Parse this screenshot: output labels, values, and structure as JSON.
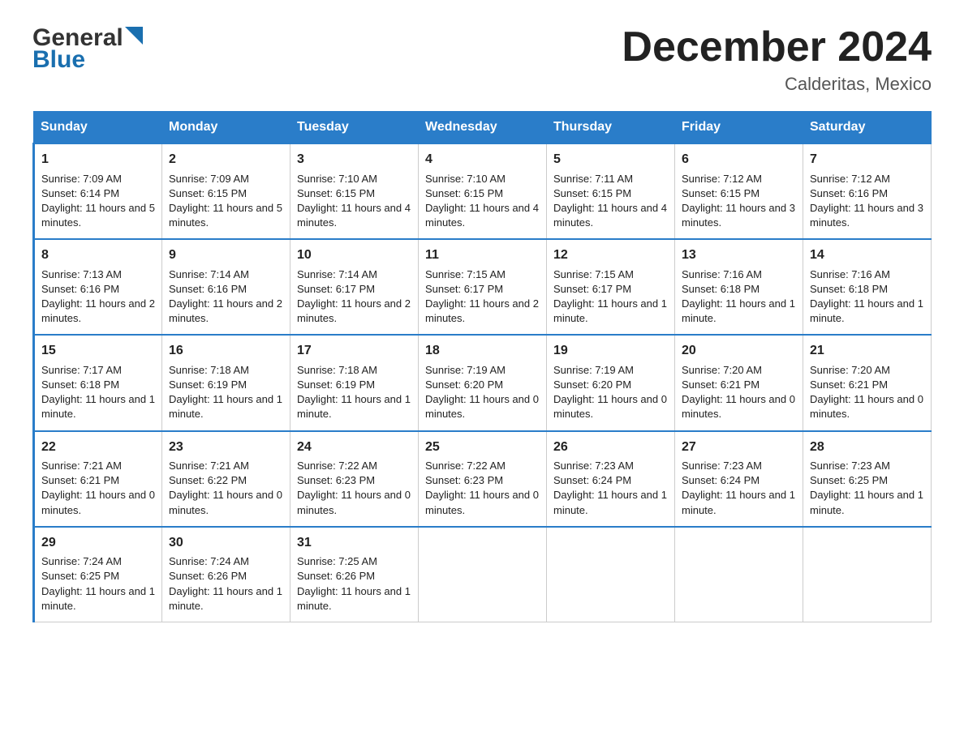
{
  "header": {
    "logo_general": "General",
    "logo_blue": "Blue",
    "month_title": "December 2024",
    "location": "Calderitas, Mexico"
  },
  "days_of_week": [
    "Sunday",
    "Monday",
    "Tuesday",
    "Wednesday",
    "Thursday",
    "Friday",
    "Saturday"
  ],
  "weeks": [
    [
      {
        "day": "1",
        "sunrise": "7:09 AM",
        "sunset": "6:14 PM",
        "daylight": "11 hours and 5 minutes."
      },
      {
        "day": "2",
        "sunrise": "7:09 AM",
        "sunset": "6:15 PM",
        "daylight": "11 hours and 5 minutes."
      },
      {
        "day": "3",
        "sunrise": "7:10 AM",
        "sunset": "6:15 PM",
        "daylight": "11 hours and 4 minutes."
      },
      {
        "day": "4",
        "sunrise": "7:10 AM",
        "sunset": "6:15 PM",
        "daylight": "11 hours and 4 minutes."
      },
      {
        "day": "5",
        "sunrise": "7:11 AM",
        "sunset": "6:15 PM",
        "daylight": "11 hours and 4 minutes."
      },
      {
        "day": "6",
        "sunrise": "7:12 AM",
        "sunset": "6:15 PM",
        "daylight": "11 hours and 3 minutes."
      },
      {
        "day": "7",
        "sunrise": "7:12 AM",
        "sunset": "6:16 PM",
        "daylight": "11 hours and 3 minutes."
      }
    ],
    [
      {
        "day": "8",
        "sunrise": "7:13 AM",
        "sunset": "6:16 PM",
        "daylight": "11 hours and 2 minutes."
      },
      {
        "day": "9",
        "sunrise": "7:14 AM",
        "sunset": "6:16 PM",
        "daylight": "11 hours and 2 minutes."
      },
      {
        "day": "10",
        "sunrise": "7:14 AM",
        "sunset": "6:17 PM",
        "daylight": "11 hours and 2 minutes."
      },
      {
        "day": "11",
        "sunrise": "7:15 AM",
        "sunset": "6:17 PM",
        "daylight": "11 hours and 2 minutes."
      },
      {
        "day": "12",
        "sunrise": "7:15 AM",
        "sunset": "6:17 PM",
        "daylight": "11 hours and 1 minute."
      },
      {
        "day": "13",
        "sunrise": "7:16 AM",
        "sunset": "6:18 PM",
        "daylight": "11 hours and 1 minute."
      },
      {
        "day": "14",
        "sunrise": "7:16 AM",
        "sunset": "6:18 PM",
        "daylight": "11 hours and 1 minute."
      }
    ],
    [
      {
        "day": "15",
        "sunrise": "7:17 AM",
        "sunset": "6:18 PM",
        "daylight": "11 hours and 1 minute."
      },
      {
        "day": "16",
        "sunrise": "7:18 AM",
        "sunset": "6:19 PM",
        "daylight": "11 hours and 1 minute."
      },
      {
        "day": "17",
        "sunrise": "7:18 AM",
        "sunset": "6:19 PM",
        "daylight": "11 hours and 1 minute."
      },
      {
        "day": "18",
        "sunrise": "7:19 AM",
        "sunset": "6:20 PM",
        "daylight": "11 hours and 0 minutes."
      },
      {
        "day": "19",
        "sunrise": "7:19 AM",
        "sunset": "6:20 PM",
        "daylight": "11 hours and 0 minutes."
      },
      {
        "day": "20",
        "sunrise": "7:20 AM",
        "sunset": "6:21 PM",
        "daylight": "11 hours and 0 minutes."
      },
      {
        "day": "21",
        "sunrise": "7:20 AM",
        "sunset": "6:21 PM",
        "daylight": "11 hours and 0 minutes."
      }
    ],
    [
      {
        "day": "22",
        "sunrise": "7:21 AM",
        "sunset": "6:21 PM",
        "daylight": "11 hours and 0 minutes."
      },
      {
        "day": "23",
        "sunrise": "7:21 AM",
        "sunset": "6:22 PM",
        "daylight": "11 hours and 0 minutes."
      },
      {
        "day": "24",
        "sunrise": "7:22 AM",
        "sunset": "6:23 PM",
        "daylight": "11 hours and 0 minutes."
      },
      {
        "day": "25",
        "sunrise": "7:22 AM",
        "sunset": "6:23 PM",
        "daylight": "11 hours and 0 minutes."
      },
      {
        "day": "26",
        "sunrise": "7:23 AM",
        "sunset": "6:24 PM",
        "daylight": "11 hours and 1 minute."
      },
      {
        "day": "27",
        "sunrise": "7:23 AM",
        "sunset": "6:24 PM",
        "daylight": "11 hours and 1 minute."
      },
      {
        "day": "28",
        "sunrise": "7:23 AM",
        "sunset": "6:25 PM",
        "daylight": "11 hours and 1 minute."
      }
    ],
    [
      {
        "day": "29",
        "sunrise": "7:24 AM",
        "sunset": "6:25 PM",
        "daylight": "11 hours and 1 minute."
      },
      {
        "day": "30",
        "sunrise": "7:24 AM",
        "sunset": "6:26 PM",
        "daylight": "11 hours and 1 minute."
      },
      {
        "day": "31",
        "sunrise": "7:25 AM",
        "sunset": "6:26 PM",
        "daylight": "11 hours and 1 minute."
      },
      null,
      null,
      null,
      null
    ]
  ]
}
